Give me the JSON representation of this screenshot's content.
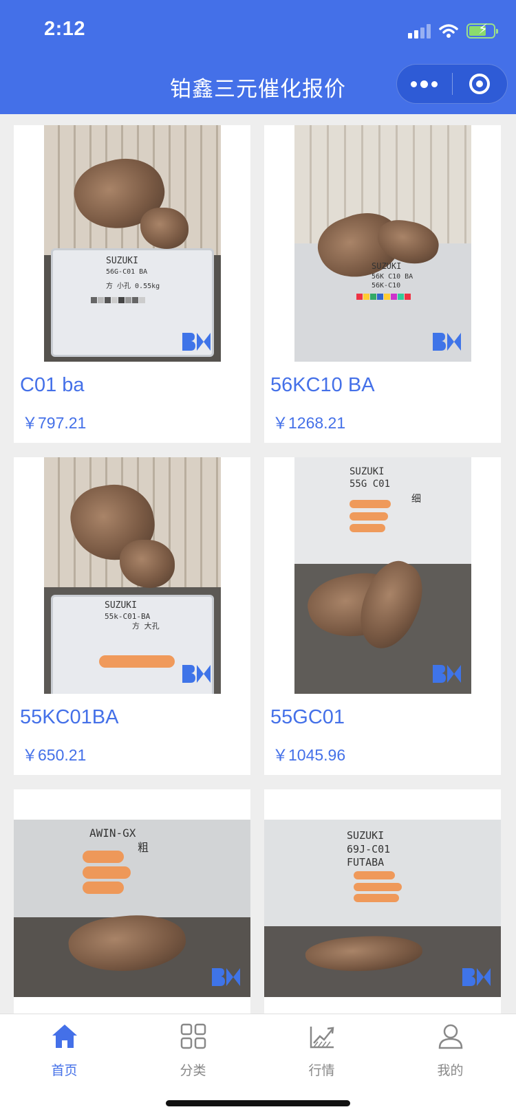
{
  "status_bar": {
    "time": "2:12"
  },
  "nav": {
    "title": "铂鑫三元催化报价",
    "more_icon": "more-dots-icon",
    "close_icon": "target-circle-icon"
  },
  "products": [
    {
      "name": "C01 ba",
      "price": "￥797.21",
      "photo_text": [
        "SUZUKI",
        "56G-C01 BA",
        "方 小孔 0.55kg"
      ]
    },
    {
      "name": "56KC10 BA",
      "price": "￥1268.21",
      "photo_text": [
        "SUZUKI",
        "56K C10 BA",
        "56K-C10"
      ]
    },
    {
      "name": "55KC01BA",
      "price": "￥650.21",
      "photo_text": [
        "SUZUKI",
        "55k-C01-BA",
        "方 大孔"
      ]
    },
    {
      "name": "55GC01",
      "price": "￥1045.96",
      "photo_text": [
        "SUZUKI",
        "55G C01",
        "细"
      ]
    },
    {
      "name": "",
      "price": "",
      "photo_text": [
        "AWIN-GX",
        "粗"
      ]
    },
    {
      "name": "",
      "price": "",
      "photo_text": [
        "SUZUKI",
        "69J-C01",
        "FUTABA"
      ]
    }
  ],
  "tabbar": {
    "items": [
      {
        "label": "首页",
        "icon": "home-icon",
        "active": true
      },
      {
        "label": "分类",
        "icon": "grid-category-icon",
        "active": false
      },
      {
        "label": "行情",
        "icon": "market-trend-icon",
        "active": false
      },
      {
        "label": "我的",
        "icon": "user-icon",
        "active": false
      }
    ]
  },
  "colors": {
    "brand": "#4470e8",
    "background": "#eeeeee",
    "tab_inactive": "#888888"
  }
}
